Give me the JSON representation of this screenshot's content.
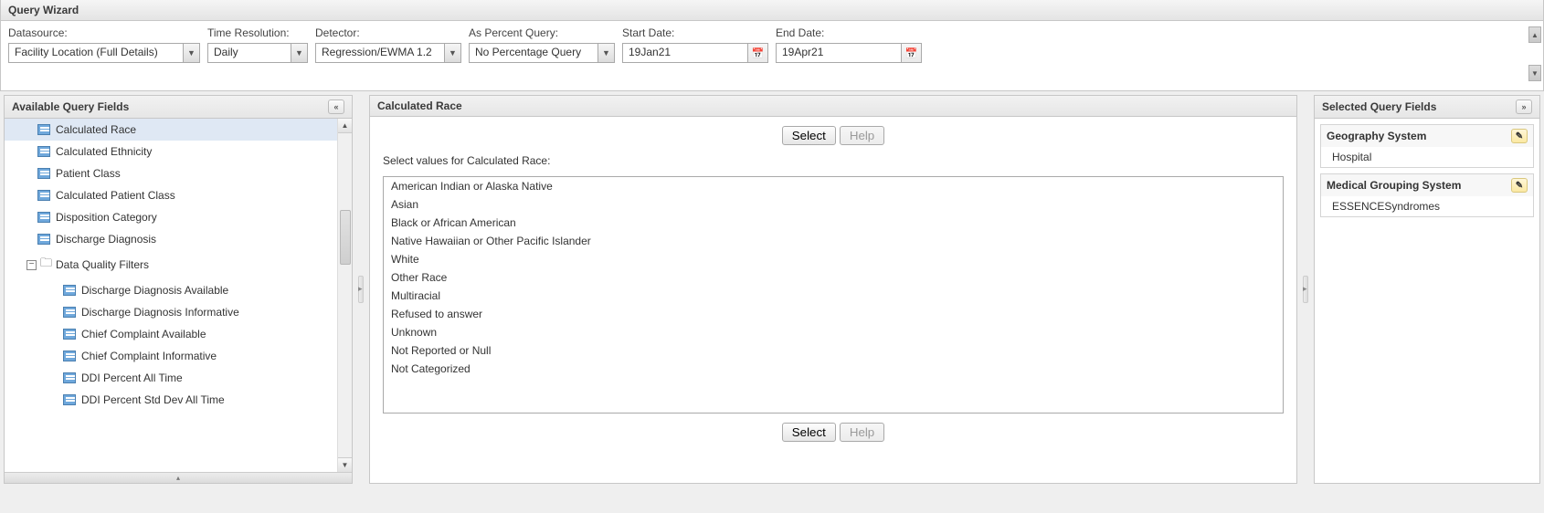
{
  "title": "Query Wizard",
  "params": {
    "datasource": {
      "label": "Datasource:",
      "value": "Facility Location (Full Details)"
    },
    "timeres": {
      "label": "Time Resolution:",
      "value": "Daily"
    },
    "detector": {
      "label": "Detector:",
      "value": "Regression/EWMA 1.2"
    },
    "percent": {
      "label": "As Percent Query:",
      "value": "No Percentage Query"
    },
    "start": {
      "label": "Start Date:",
      "value": "19Jan21"
    },
    "end": {
      "label": "End Date:",
      "value": "19Apr21"
    }
  },
  "left": {
    "header": "Available Query Fields",
    "items": [
      {
        "label": "Calculated Race",
        "indent": 1,
        "selected": true
      },
      {
        "label": "Calculated Ethnicity",
        "indent": 1
      },
      {
        "label": "Patient Class",
        "indent": 1
      },
      {
        "label": "Calculated Patient Class",
        "indent": 1
      },
      {
        "label": "Disposition Category",
        "indent": 1
      },
      {
        "label": "Discharge Diagnosis",
        "indent": 1
      }
    ],
    "folder": "Data Quality Filters",
    "subitems": [
      {
        "label": "Discharge Diagnosis Available"
      },
      {
        "label": "Discharge Diagnosis Informative"
      },
      {
        "label": "Chief Complaint Available"
      },
      {
        "label": "Chief Complaint Informative"
      },
      {
        "label": "DDI Percent All Time"
      },
      {
        "label": "DDI Percent Std Dev All Time"
      }
    ]
  },
  "center": {
    "header": "Calculated Race",
    "select_label": "Select",
    "help_label": "Help",
    "instruction": "Select values for Calculated Race:",
    "values": [
      "American Indian or Alaska Native",
      "Asian",
      "Black or African American",
      "Native Hawaiian or Other Pacific Islander",
      "White",
      "Other Race",
      "Multiracial",
      "Refused to answer",
      "Unknown",
      "Not Reported or Null",
      "Not Categorized"
    ]
  },
  "right": {
    "header": "Selected Query Fields",
    "blocks": [
      {
        "title": "Geography System",
        "value": "Hospital"
      },
      {
        "title": "Medical Grouping System",
        "value": "ESSENCESyndromes"
      }
    ]
  }
}
